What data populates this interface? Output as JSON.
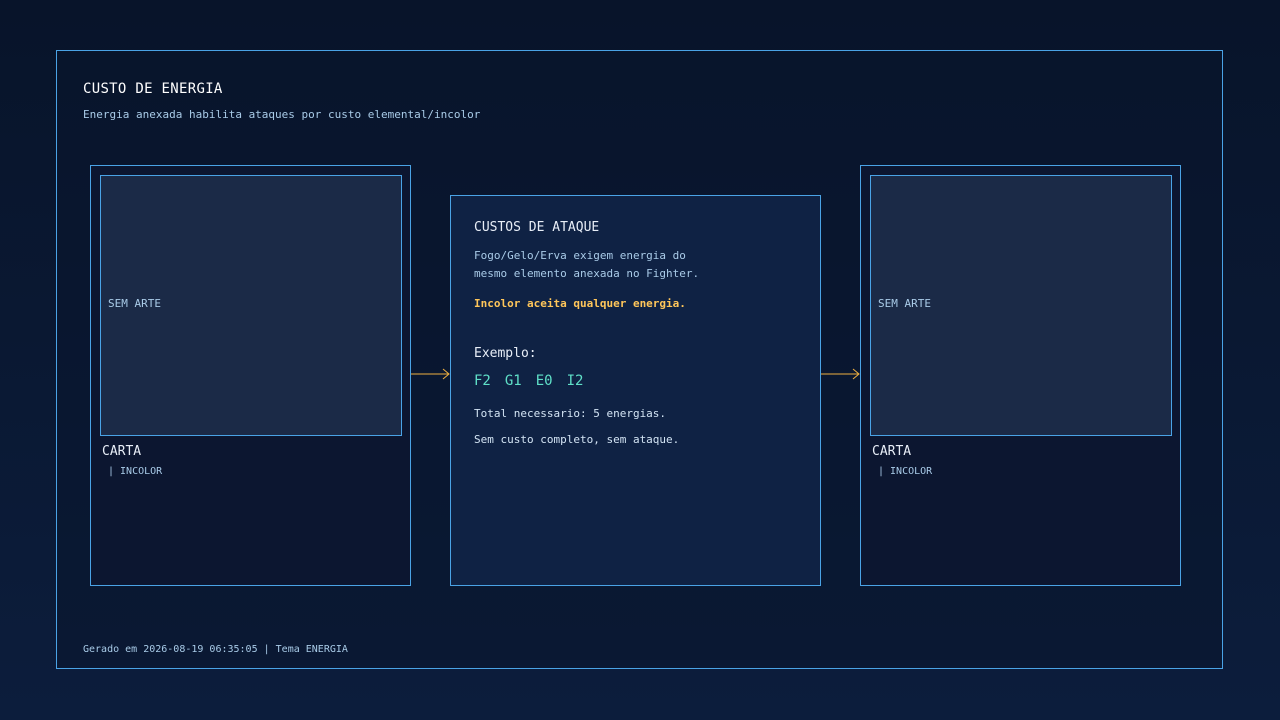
{
  "header": {
    "title": "CUSTO DE ENERGIA",
    "subtitle": "Energia anexada habilita ataques por custo elemental/incolor"
  },
  "cards": [
    {
      "art_label": "SEM ARTE",
      "name": "CARTA",
      "type": "| INCOLOR"
    },
    {
      "art_label": "SEM ARTE",
      "name": "CARTA",
      "type": "| INCOLOR"
    }
  ],
  "panel": {
    "title": "CUSTOS DE ATAQUE",
    "description_line1": "Fogo/Gelo/Erva exigem energia do",
    "description_line2": "mesmo elemento anexada no Fighter.",
    "highlight": "Incolor aceita qualquer energia.",
    "example_label": "Exemplo:",
    "codes": [
      "F2",
      "G1",
      "E0",
      "I2"
    ],
    "total": "Total necessario: 5 energias.",
    "note": "Sem custo completo, sem ataque."
  },
  "footer": {
    "text": "Gerado em 2026-08-19 06:35:05 | Tema ENERGIA"
  },
  "colors": {
    "accent_border": "#4aa3e6",
    "highlight": "#ffc65a",
    "codes": "#5fe0c8",
    "arrow": "#f0b040"
  },
  "icons": {
    "arrow": "arrow-right-icon"
  }
}
